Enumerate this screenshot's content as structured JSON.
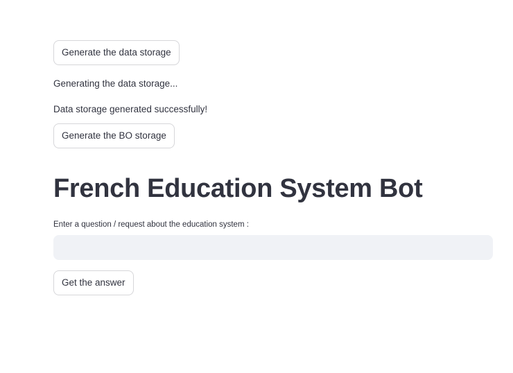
{
  "buttons": {
    "generate_data": "Generate the data storage",
    "generate_bo": "Generate the BO storage",
    "get_answer": "Get the answer"
  },
  "messages": {
    "generating": "Generating the data storage...",
    "success": "Data storage generated successfully!"
  },
  "page": {
    "title": "French Education System Bot"
  },
  "question_input": {
    "label": "Enter a question / request about the education system :",
    "value": "",
    "placeholder": ""
  },
  "colors": {
    "text": "#31333f",
    "button_border": "#d6d6d9",
    "input_background": "#f0f2f6",
    "page_background": "#ffffff"
  }
}
